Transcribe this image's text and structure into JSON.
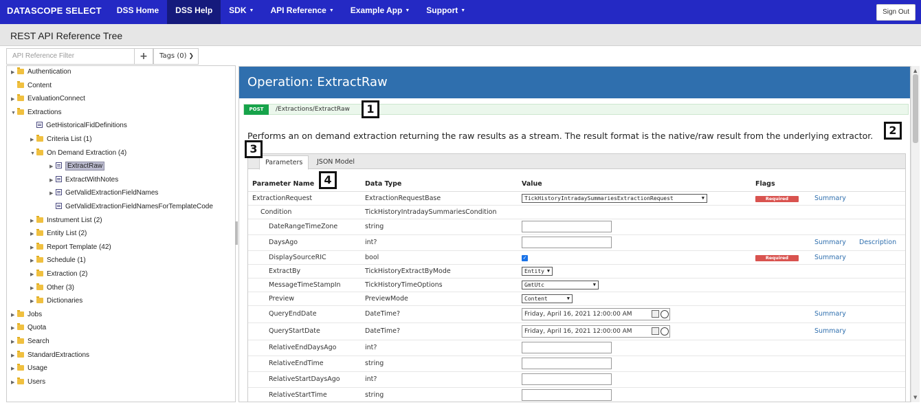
{
  "nav": {
    "brand": "DATASCOPE SELECT",
    "items": [
      {
        "label": "DSS Home",
        "caret": false,
        "active": false
      },
      {
        "label": "DSS Help",
        "caret": false,
        "active": true
      },
      {
        "label": "SDK",
        "caret": true,
        "active": false
      },
      {
        "label": "API Reference",
        "caret": true,
        "active": false
      },
      {
        "label": "Example App",
        "caret": true,
        "active": false
      },
      {
        "label": "Support",
        "caret": true,
        "active": false
      }
    ],
    "signout": "Sign Out"
  },
  "subheader": {
    "title": "REST API Reference Tree"
  },
  "filter": {
    "placeholder": "API Reference Filter",
    "plus": "+",
    "tags": "Tags (0)"
  },
  "tree": {
    "items": [
      {
        "label": "Authentication",
        "kind": "folder",
        "arrow": "▶",
        "level": 0
      },
      {
        "label": "Content",
        "kind": "folder",
        "arrow": "",
        "level": 0
      },
      {
        "label": "EvaluationConnect",
        "kind": "folder",
        "arrow": "▶",
        "level": 0
      },
      {
        "label": "Extractions",
        "kind": "folder",
        "arrow": "▼",
        "level": 0
      },
      {
        "label": "GetHistoricalFidDefinitions",
        "kind": "op",
        "arrow": "",
        "level": 1
      },
      {
        "label": "Criteria List (1)",
        "kind": "folder",
        "arrow": "▶",
        "level": 1
      },
      {
        "label": "On Demand Extraction (4)",
        "kind": "folder",
        "arrow": "▼",
        "level": 1
      },
      {
        "label": "ExtractRaw",
        "kind": "op",
        "arrow": "▶",
        "level": 2,
        "selected": true
      },
      {
        "label": "ExtractWithNotes",
        "kind": "op",
        "arrow": "▶",
        "level": 2
      },
      {
        "label": "GetValidExtractionFieldNames",
        "kind": "op",
        "arrow": "▶",
        "level": 2
      },
      {
        "label": "GetValidExtractionFieldNamesForTemplateCode",
        "kind": "op",
        "arrow": "",
        "level": 2
      },
      {
        "label": "Instrument List (2)",
        "kind": "folder",
        "arrow": "▶",
        "level": 1
      },
      {
        "label": "Entity List (2)",
        "kind": "folder",
        "arrow": "▶",
        "level": 1
      },
      {
        "label": "Report Template (42)",
        "kind": "folder",
        "arrow": "▶",
        "level": 1
      },
      {
        "label": "Schedule (1)",
        "kind": "folder",
        "arrow": "▶",
        "level": 1
      },
      {
        "label": "Extraction (2)",
        "kind": "folder",
        "arrow": "▶",
        "level": 1
      },
      {
        "label": "Other (3)",
        "kind": "folder",
        "arrow": "▶",
        "level": 1
      },
      {
        "label": "Dictionaries",
        "kind": "folder",
        "arrow": "▶",
        "level": 1
      },
      {
        "label": "Jobs",
        "kind": "folder",
        "arrow": "▶",
        "level": 0
      },
      {
        "label": "Quota",
        "kind": "folder",
        "arrow": "▶",
        "level": 0
      },
      {
        "label": "Search",
        "kind": "folder",
        "arrow": "▶",
        "level": 0
      },
      {
        "label": "StandardExtractions",
        "kind": "folder",
        "arrow": "▶",
        "level": 0
      },
      {
        "label": "Usage",
        "kind": "folder",
        "arrow": "▶",
        "level": 0
      },
      {
        "label": "Users",
        "kind": "folder",
        "arrow": "▶",
        "level": 0
      }
    ]
  },
  "operation": {
    "title": "Operation: ExtractRaw",
    "method": "POST",
    "path": "/Extractions/ExtractRaw",
    "description": "Performs an on demand extraction returning the raw results as a stream. The result format is the native/raw result from the underlying extractor."
  },
  "markers": [
    "1",
    "2",
    "3",
    "4"
  ],
  "tabs": [
    "Parameters",
    "JSON Model"
  ],
  "params": {
    "headers": [
      "Parameter Name",
      "Data Type",
      "Value",
      "Flags",
      "",
      ""
    ],
    "rows": [
      {
        "name": "ExtractionRequest",
        "type": "ExtractionRequestBase",
        "control": "select",
        "value": "TickHistoryIntradaySummariesExtractionRequest",
        "required": true,
        "summary": "Summary",
        "description": "",
        "indent": 0
      },
      {
        "name": "Condition",
        "type": "TickHistoryIntradaySummariesCondition",
        "control": "none",
        "value": "",
        "required": false,
        "summary": "",
        "description": "",
        "indent": 1
      },
      {
        "name": "DateRangeTimeZone",
        "type": "string",
        "control": "input",
        "value": "",
        "required": false,
        "summary": "",
        "description": "",
        "indent": 2
      },
      {
        "name": "DaysAgo",
        "type": "int?",
        "control": "input",
        "value": "",
        "required": false,
        "summary": "Summary",
        "description": "Description",
        "indent": 2
      },
      {
        "name": "DisplaySourceRIC",
        "type": "bool",
        "control": "checkbox",
        "value": "✓",
        "required": true,
        "summary": "Summary",
        "description": "",
        "indent": 2
      },
      {
        "name": "ExtractBy",
        "type": "TickHistoryExtractByMode",
        "control": "select",
        "value": "Entity",
        "required": false,
        "summary": "",
        "description": "",
        "indent": 2
      },
      {
        "name": "MessageTimeStampIn",
        "type": "TickHistoryTimeOptions",
        "control": "select",
        "value": "GmtUtc",
        "required": false,
        "summary": "",
        "description": "",
        "indent": 2
      },
      {
        "name": "Preview",
        "type": "PreviewMode",
        "control": "select",
        "value": "Content",
        "required": false,
        "summary": "",
        "description": "",
        "indent": 2
      },
      {
        "name": "QueryEndDate",
        "type": "DateTime?",
        "control": "date",
        "value": "Friday, April 16, 2021 12:00:00 AM",
        "required": false,
        "summary": "Summary",
        "description": "",
        "indent": 2
      },
      {
        "name": "QueryStartDate",
        "type": "DateTime?",
        "control": "date",
        "value": "Friday, April 16, 2021 12:00:00 AM",
        "required": false,
        "summary": "Summary",
        "description": "",
        "indent": 2
      },
      {
        "name": "RelativeEndDaysAgo",
        "type": "int?",
        "control": "input",
        "value": "",
        "required": false,
        "summary": "",
        "description": "",
        "indent": 2
      },
      {
        "name": "RelativeEndTime",
        "type": "string",
        "control": "input",
        "value": "",
        "required": false,
        "summary": "",
        "description": "",
        "indent": 2
      },
      {
        "name": "RelativeStartDaysAgo",
        "type": "int?",
        "control": "input",
        "value": "",
        "required": false,
        "summary": "",
        "description": "",
        "indent": 2
      },
      {
        "name": "RelativeStartTime",
        "type": "string",
        "control": "input",
        "value": "",
        "required": false,
        "summary": "",
        "description": "",
        "indent": 2
      }
    ],
    "required_label": "Required"
  },
  "colors": {
    "nav": "#2429c4",
    "nav_active": "#151a7c",
    "header": "#2f6fae",
    "post": "#16a34a",
    "required": "#d9534f"
  }
}
